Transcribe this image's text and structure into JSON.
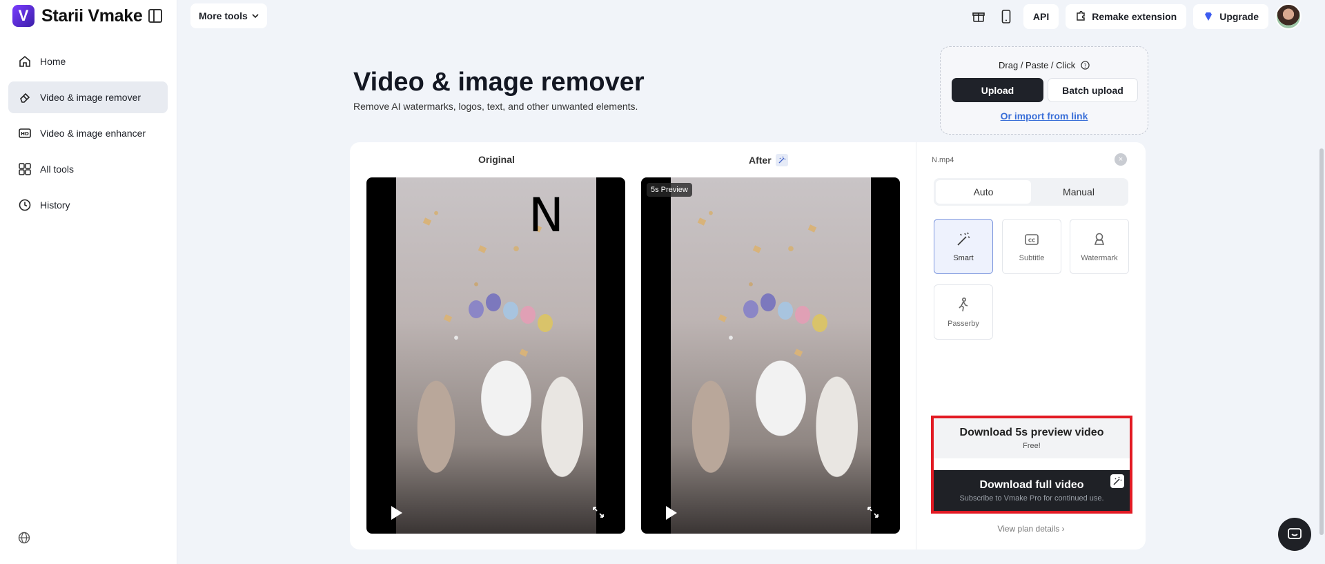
{
  "brand": {
    "name": "Starii Vmake",
    "logo_letter": "V"
  },
  "sidebar": {
    "items": [
      {
        "label": "Home",
        "icon": "home-icon"
      },
      {
        "label": "Video & image remover",
        "icon": "eraser-icon",
        "active": true
      },
      {
        "label": "Video & image enhancer",
        "icon": "hd-icon"
      },
      {
        "label": "All tools",
        "icon": "grid-icon"
      },
      {
        "label": "History",
        "icon": "clock-icon"
      }
    ]
  },
  "topbar": {
    "more_tools": "More tools",
    "api": "API",
    "remake_extension": "Remake extension",
    "upgrade": "Upgrade"
  },
  "header": {
    "title": "Video & image remover",
    "subtitle": "Remove AI watermarks, logos, text, and other unwanted elements."
  },
  "upload": {
    "drag_label": "Drag / Paste / Click",
    "upload_label": "Upload",
    "batch_label": "Batch upload",
    "import_link": "Or import from link"
  },
  "preview": {
    "original_label": "Original",
    "after_label": "After",
    "preview_badge": "5s Preview",
    "watermark_text": "N"
  },
  "panel": {
    "file_name": "N.mp4",
    "close": "×",
    "tabs": [
      {
        "label": "Auto",
        "active": true
      },
      {
        "label": "Manual",
        "active": false
      }
    ],
    "options": [
      {
        "label": "Smart",
        "active": true
      },
      {
        "label": "Subtitle",
        "active": false
      },
      {
        "label": "Watermark",
        "active": false
      },
      {
        "label": "Passerby",
        "active": false
      }
    ],
    "download_preview": {
      "title": "Download 5s preview video",
      "sub": "Free!"
    },
    "download_full": {
      "title": "Download full video",
      "sub": "Subscribe to Vmake Pro for continued use."
    },
    "view_plan": "View plan details ›"
  },
  "colors": {
    "accent_red": "#e21a23",
    "brand_purple": "#6a2cff",
    "link_blue": "#3a6fd8",
    "dark": "#1f2126"
  }
}
